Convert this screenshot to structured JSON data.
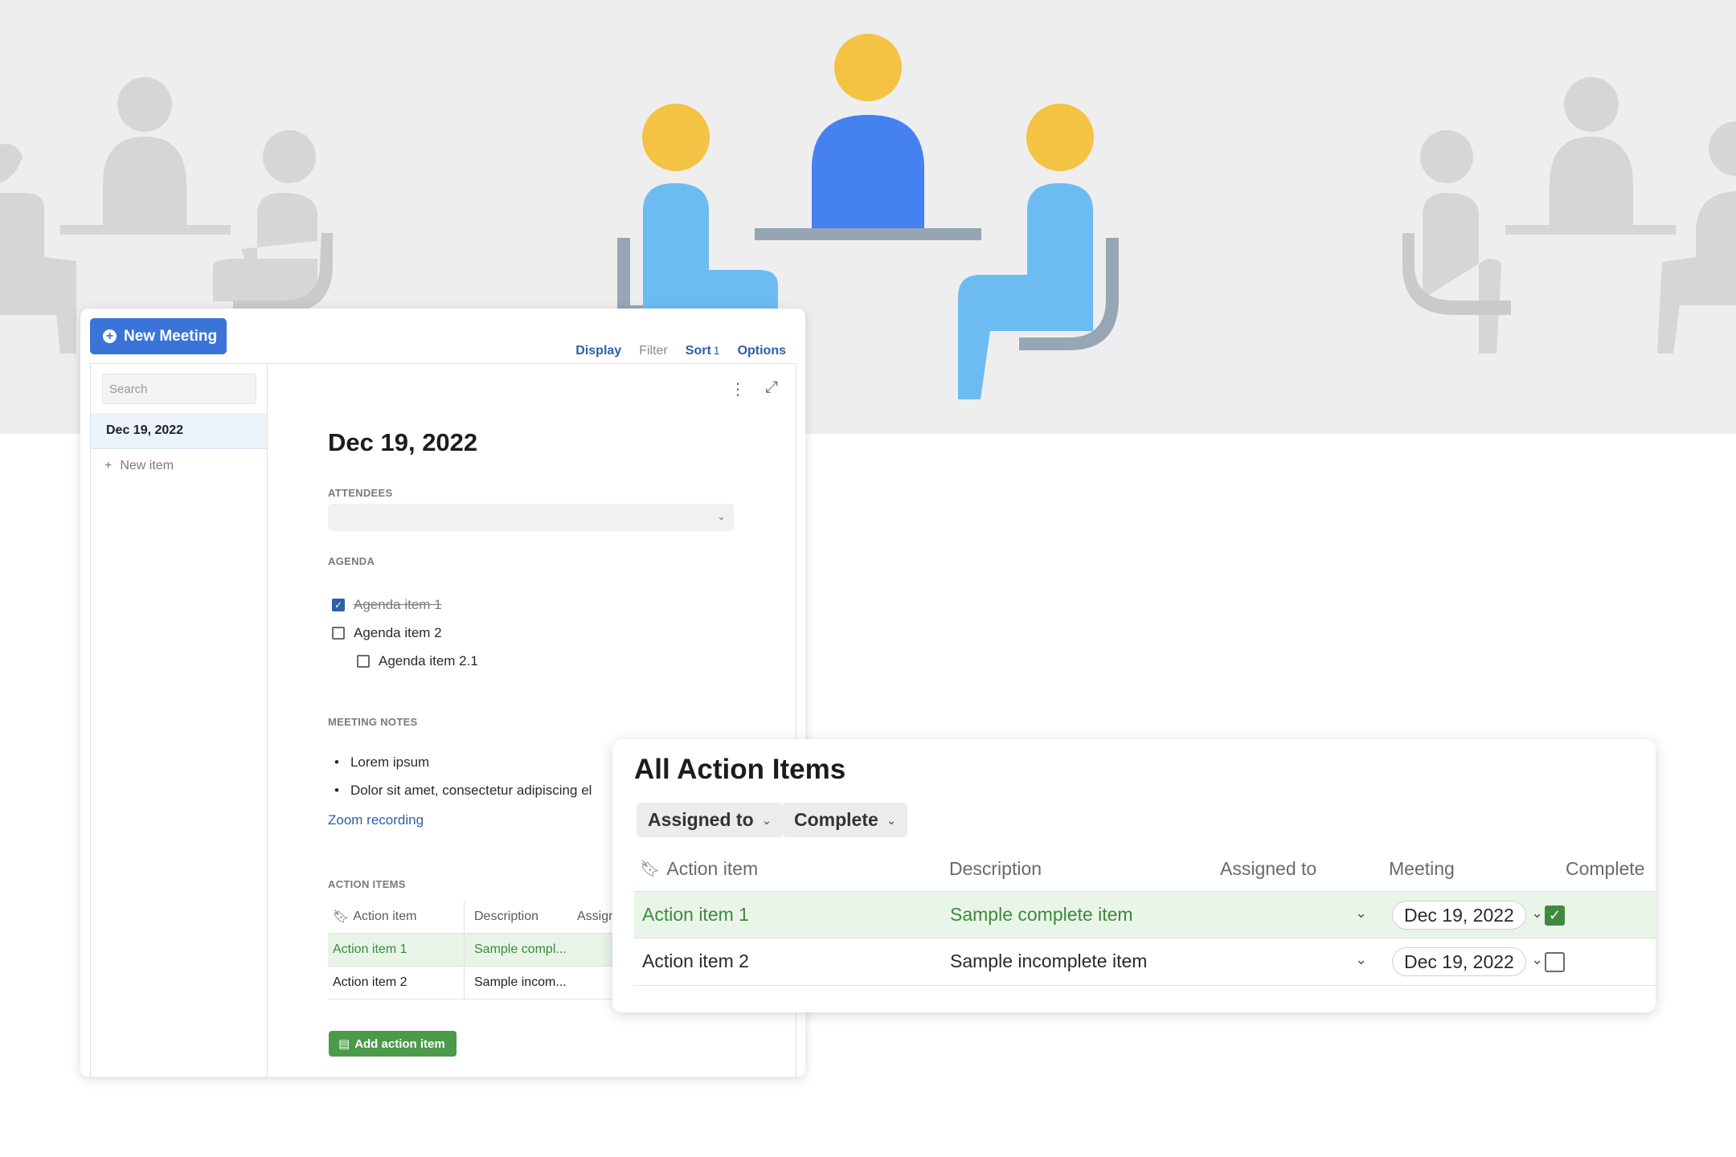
{
  "app": {
    "new_meeting_label": "New Meeting",
    "toolbar": {
      "display": "Display",
      "filter": "Filter",
      "sort": "Sort",
      "sort_count": "1",
      "options": "Options"
    },
    "sidebar": {
      "search_placeholder": "Search",
      "selected_item": "Dec 19, 2022",
      "new_item": "New item"
    },
    "doc": {
      "title": "Dec 19, 2022",
      "attendees_label": "ATTENDEES",
      "agenda_label": "AGENDA",
      "agenda_items": [
        {
          "label": "Agenda item 1",
          "checked": true
        },
        {
          "label": "Agenda item 2",
          "checked": false
        },
        {
          "label": "Agenda item 2.1",
          "checked": false
        }
      ],
      "notes_label": "MEETING NOTES",
      "notes": [
        "Lorem ipsum",
        "Dolor sit amet, consectetur adipiscing el"
      ],
      "zoom_link": "Zoom recording",
      "action_items_label": "ACTION ITEMS",
      "action_table": {
        "headers": [
          "Action item",
          "Description",
          "Assign"
        ],
        "rows": [
          [
            "Action item 1",
            "Sample compl..."
          ],
          [
            "Action item 2",
            "Sample incom..."
          ]
        ]
      },
      "add_action_label": "Add action item"
    }
  },
  "action_items": {
    "title": "All Action Items",
    "filters": [
      "Assigned to",
      "Complete"
    ],
    "headers": [
      "Action item",
      "Description",
      "Assigned to",
      "Meeting",
      "Complete"
    ],
    "rows": [
      {
        "item": "Action item 1",
        "description": "Sample complete item",
        "meeting": "Dec 19, 2022",
        "complete": true
      },
      {
        "item": "Action item 2",
        "description": "Sample incomplete item",
        "meeting": "Dec 19, 2022",
        "complete": false
      }
    ]
  },
  "colors": {
    "accent_blue": "#3a74d8",
    "link_blue": "#2d5fa8",
    "complete_green": "#3f8a3f",
    "hero_bg": "#eeeeee",
    "figure_yellow": "#f4c343",
    "figure_blue": "#4581f0",
    "figure_light_blue": "#6cbcf2",
    "figure_gray": "#d6d6d6"
  }
}
